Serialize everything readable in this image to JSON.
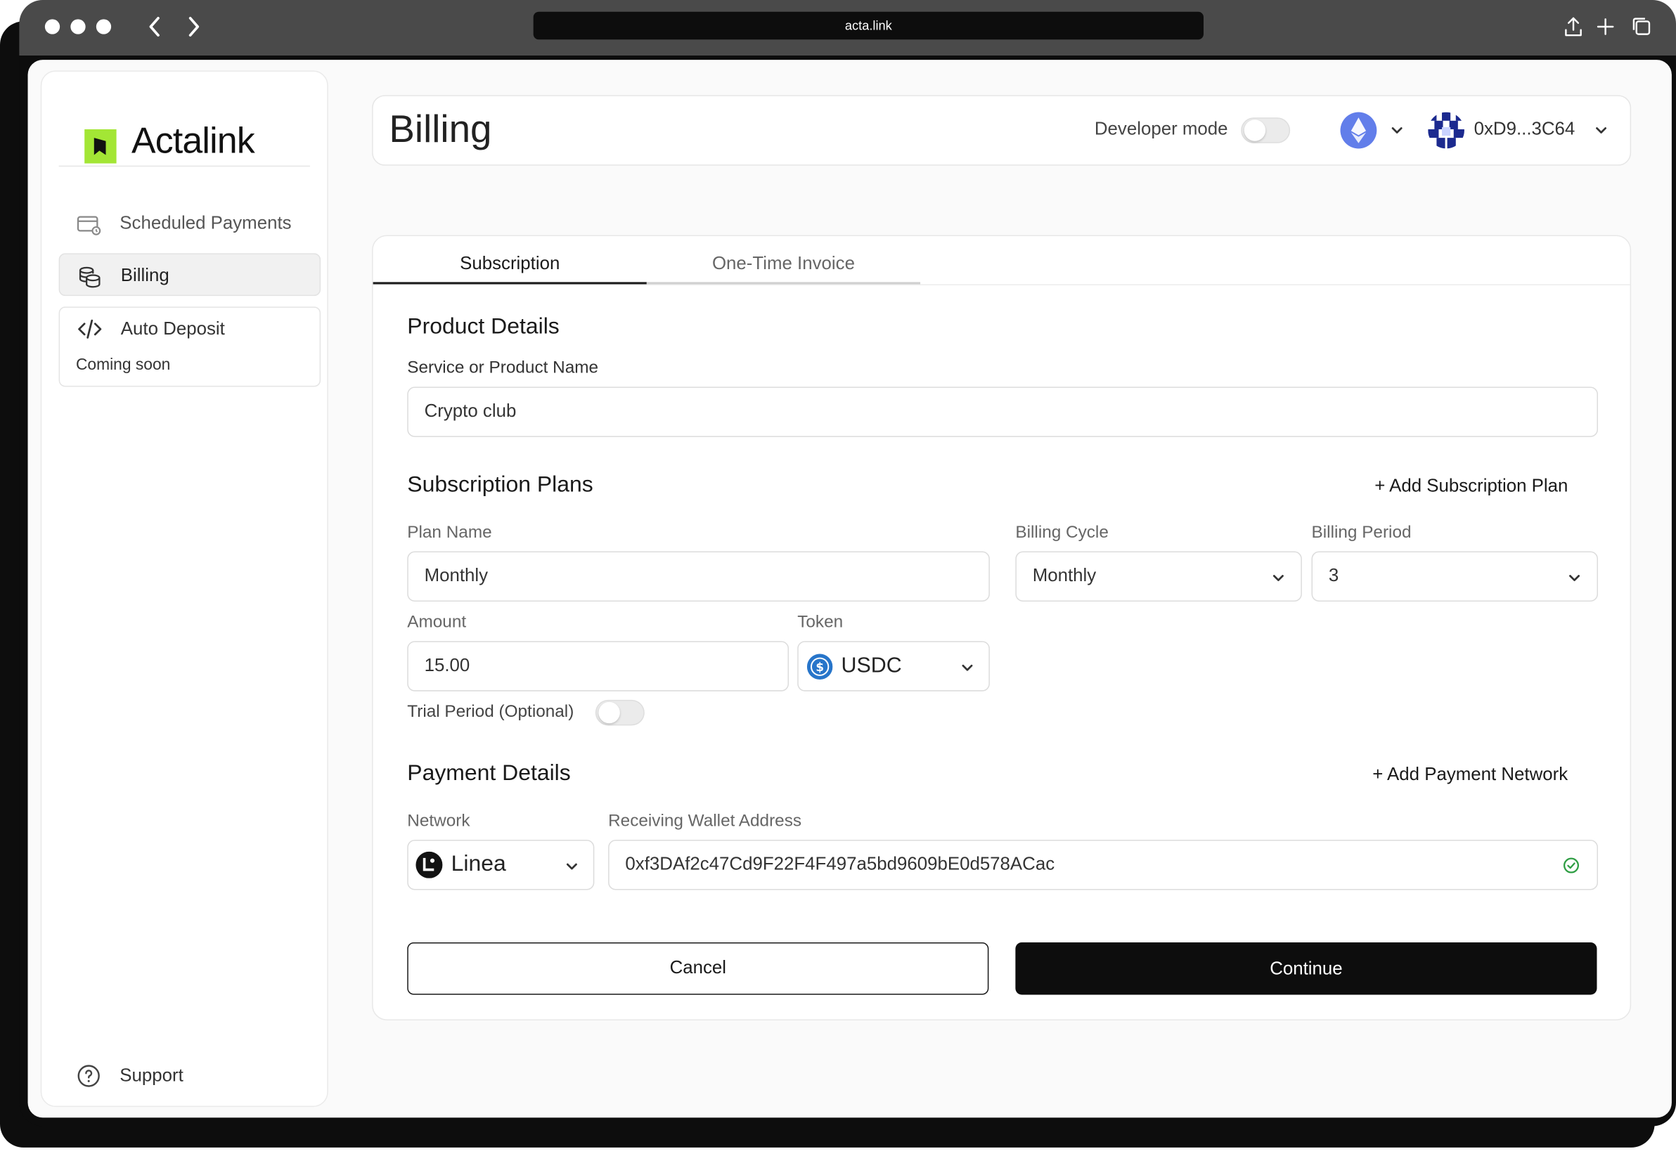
{
  "browser": {
    "url": "acta.link",
    "back_icon": "chevron-left-icon",
    "forward_icon": "chevron-right-icon"
  },
  "sidebar": {
    "brand": "Actalink",
    "brand_color": "#a3e635",
    "items": [
      {
        "label": "Scheduled Payments",
        "icon": "card-schedule-icon",
        "active": false
      },
      {
        "label": "Billing",
        "icon": "coins-icon",
        "active": true
      },
      {
        "label": "Auto Deposit",
        "icon": "code-icon",
        "active": false,
        "note": "Coming soon"
      }
    ],
    "support_label": "Support"
  },
  "header": {
    "title": "Billing",
    "developer_mode_label": "Developer mode",
    "developer_mode_on": false,
    "network_icon": "ethereum-icon",
    "wallet_label": "0xD9...3C64"
  },
  "tabs": [
    {
      "label": "Subscription",
      "active": true
    },
    {
      "label": "One-Time Invoice",
      "active": false
    }
  ],
  "product": {
    "section_title": "Product Details",
    "name_label": "Service or Product Name",
    "name_value": "Crypto club"
  },
  "plans": {
    "section_title": "Subscription Plans",
    "add_label": "+ Add Subscription Plan",
    "plan_name_label": "Plan Name",
    "plan_name_value": "Monthly",
    "billing_cycle_label": "Billing Cycle",
    "billing_cycle_value": "Monthly",
    "billing_period_label": "Billing Period",
    "billing_period_value": "3",
    "amount_label": "Amount",
    "amount_value": "15.00",
    "token_label": "Token",
    "token_value": "USDC",
    "trial_label": "Trial Period (Optional)",
    "trial_on": false
  },
  "payment": {
    "section_title": "Payment Details",
    "add_label": "+ Add Payment Network",
    "network_label": "Network",
    "network_value": "Linea",
    "wallet_label": "Receiving Wallet Address",
    "wallet_value": "0xf3DAf2c47Cd9F22F4F497a5bd9609bE0d578ACac",
    "valid_color": "#2f9e44"
  },
  "actions": {
    "cancel_label": "Cancel",
    "continue_label": "Continue"
  }
}
